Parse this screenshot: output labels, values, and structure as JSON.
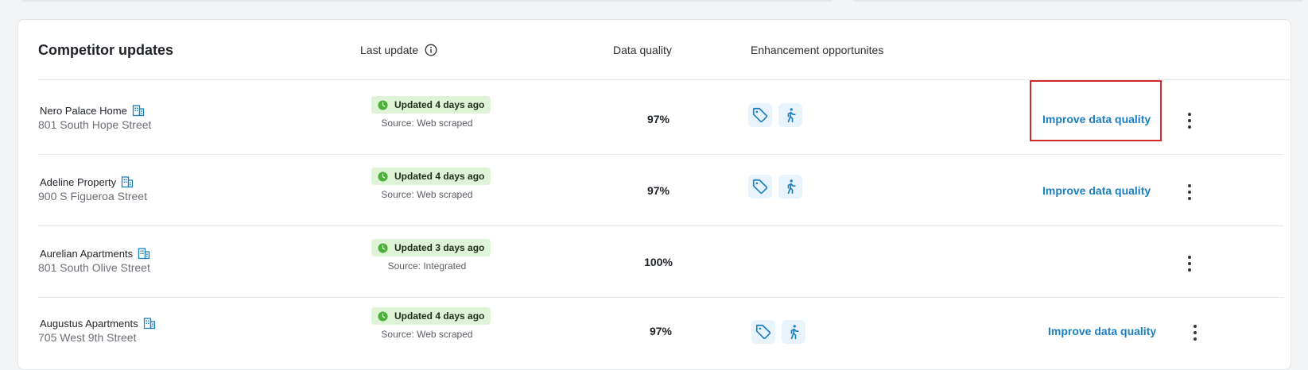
{
  "header": {
    "title": "Competitor updates",
    "col_last_update": "Last update",
    "col_data_quality": "Data quality",
    "col_enhancement": "Enhancement opportunites"
  },
  "colors": {
    "accent": "#1a7fc0",
    "badge_bg": "#dff3d6",
    "badge_icon": "#4caf3a",
    "highlight": "#d22a2a"
  },
  "rows": [
    {
      "name": "Nero Palace Home",
      "address": "801 South Hope Street",
      "status": "Updated 4 days ago",
      "source": "Source: Web scraped",
      "quality": "97%",
      "enhancements": [
        "tag-icon",
        "walking-person-icon"
      ],
      "action": "Improve data quality"
    },
    {
      "name": "Adeline  Property",
      "address": "900 S Figueroa Street",
      "status": "Updated 4 days ago",
      "source": "Source: Web scraped",
      "quality": "97%",
      "enhancements": [
        "tag-icon",
        "walking-person-icon"
      ],
      "action": "Improve data quality"
    },
    {
      "name": "Aurelian Apartments",
      "address": "801 South Olive Street",
      "status": "Updated 3 days ago",
      "source": "Source: Integrated",
      "quality": "100%",
      "enhancements": [],
      "action": ""
    },
    {
      "name": "Augustus Apartments",
      "address": "705 West 9th Street",
      "status": "Updated 4 days ago",
      "source": "Source: Web scraped",
      "quality": "97%",
      "enhancements": [
        "tag-icon",
        "walking-person-icon"
      ],
      "action": "Improve data quality"
    }
  ]
}
